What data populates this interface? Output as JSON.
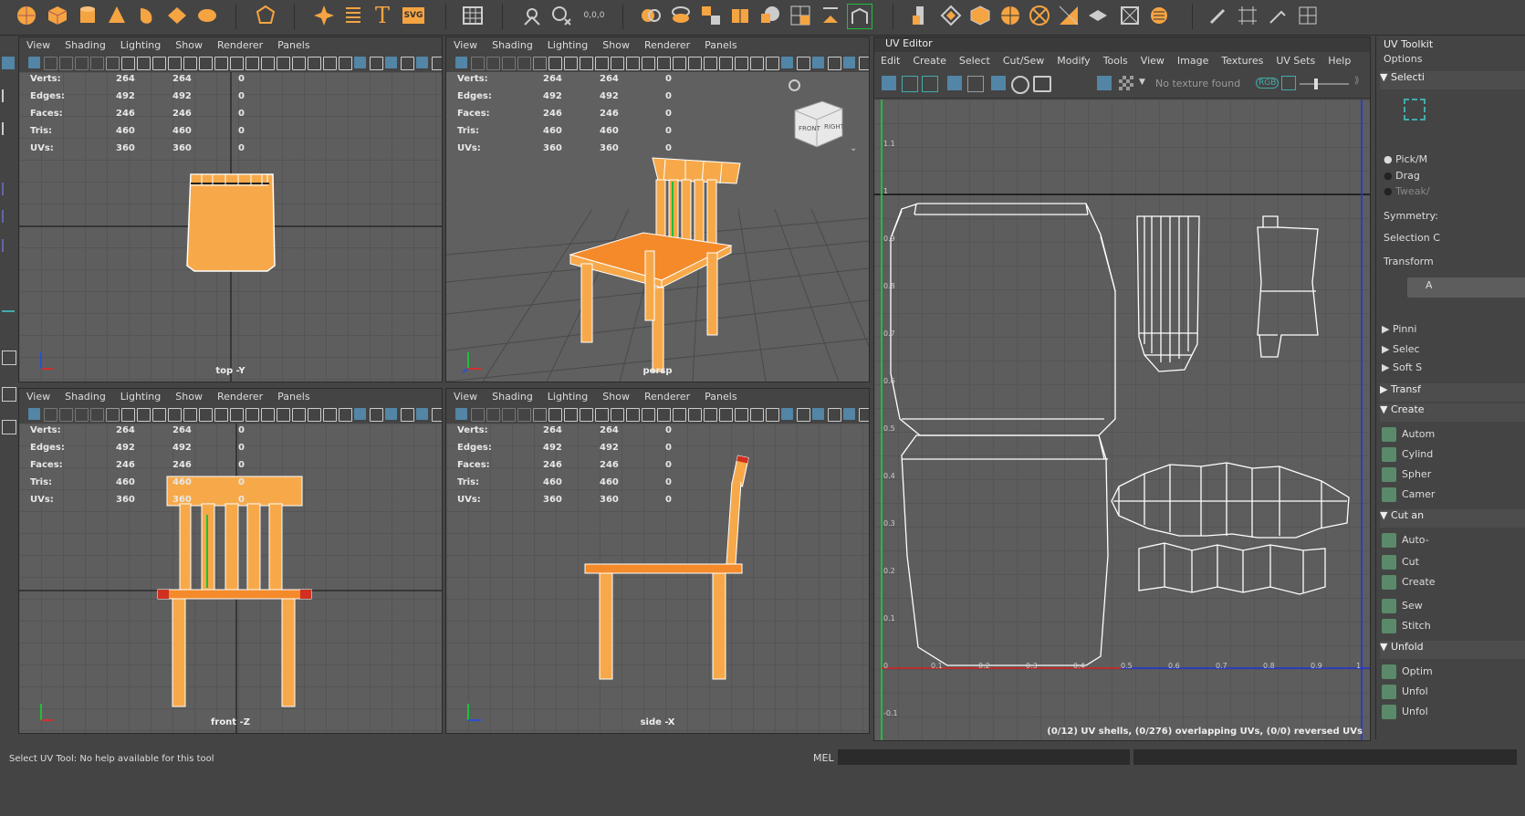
{
  "viewport_menu": [
    "View",
    "Shading",
    "Lighting",
    "Show",
    "Renderer",
    "Panels"
  ],
  "stats": [
    {
      "label": "Verts:",
      "a": "264",
      "b": "264",
      "c": "0"
    },
    {
      "label": "Edges:",
      "a": "492",
      "b": "492",
      "c": "0"
    },
    {
      "label": "Faces:",
      "a": "246",
      "b": "246",
      "c": "0"
    },
    {
      "label": "Tris:",
      "a": "460",
      "b": "460",
      "c": "0"
    },
    {
      "label": "UVs:",
      "a": "360",
      "b": "360",
      "c": "0"
    }
  ],
  "viewports": {
    "top": {
      "label": "top -Y"
    },
    "persp": {
      "label": "persp"
    },
    "front": {
      "label": "front -Z"
    },
    "side": {
      "label": "side -X"
    }
  },
  "viewcube": {
    "front": "FRONT",
    "right": "RIGHT"
  },
  "uv_editor": {
    "title": "UV Editor",
    "menu": [
      "Edit",
      "Create",
      "Select",
      "Cut/Sew",
      "Modify",
      "Tools",
      "View",
      "Image",
      "Textures",
      "UV Sets",
      "Help"
    ],
    "texture_label": "No texture found",
    "rgb_label": "RGB",
    "status": "(0/12) UV shells, (0/276) overlapping UVs, (0/0) reversed UVs",
    "y_ticks": [
      "1.1",
      "1",
      "0.9",
      "0.8",
      "0.7",
      "0.6",
      "0.5",
      "0.4",
      "0.3",
      "0.2",
      "0.1",
      "0",
      "-0.1"
    ],
    "x_ticks": [
      "0.1",
      "0.2",
      "0.3",
      "0.4",
      "0.5",
      "0.6",
      "0.7",
      "0.8",
      "0.9",
      "1"
    ]
  },
  "uv_toolkit": {
    "title": "UV Toolkit",
    "options": "Options",
    "selection_head": "Selecti",
    "radio": [
      "Pick/M",
      "Drag",
      "Tweak/"
    ],
    "symmetry": "Symmetry:",
    "selection_c": "Selection C",
    "transform": "Transform",
    "a_btn": "A",
    "collapsed": [
      "Pinni",
      "Selec",
      "Soft S",
      "Transf"
    ],
    "create_head": "Create",
    "create_items": [
      "Autom",
      "Cylind",
      "Spher",
      "Camer"
    ],
    "cut_head": "Cut an",
    "cut_items": [
      "Auto-",
      "Cut",
      "Create",
      "Sew",
      "Stitch"
    ],
    "unfold_head": "Unfold",
    "unfold_items": [
      "Optim",
      "Unfol",
      "Unfol"
    ]
  },
  "status_bar": {
    "help": "Select UV Tool: No help available for this tool",
    "mel": "MEL"
  },
  "colors": {
    "accent": "#f5a442",
    "ui": "#444444",
    "viewport": "#5e5e5e",
    "uv_green": "#1fbf3a",
    "uv_blue": "#1f35d6",
    "uv_red": "#d62020"
  }
}
